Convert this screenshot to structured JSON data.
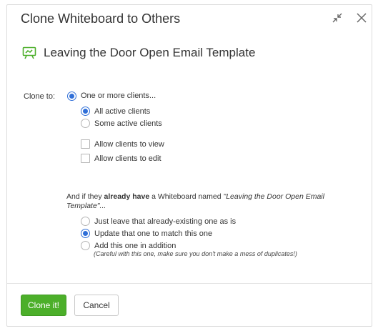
{
  "dialog": {
    "title": "Clone Whiteboard to Others",
    "header_icons": [
      "minimize-icon",
      "close-icon"
    ]
  },
  "whiteboard": {
    "icon": "whiteboard-icon",
    "name": "Leaving the Door Open Email Template",
    "accent_color": "#4caf2a"
  },
  "clone_to": {
    "label": "Clone to:",
    "option_label": "One or more clients...",
    "option_checked": true,
    "scope_options": [
      {
        "label": "All active clients",
        "checked": true
      },
      {
        "label": "Some active clients",
        "checked": false
      }
    ],
    "permissions": [
      {
        "label": "Allow clients to view",
        "checked": false
      },
      {
        "label": "Allow clients to edit",
        "checked": false
      }
    ]
  },
  "existing": {
    "question_prefix": "And if they ",
    "question_bold": "already have",
    "question_mid": " a Whiteboard named ",
    "question_name": "\"Leaving the Door Open Email Template\"",
    "question_suffix": "...",
    "options": [
      {
        "label": "Just leave that already-existing one as is",
        "checked": false
      },
      {
        "label": "Update that one to match this one",
        "checked": true
      },
      {
        "label": "Add this one in addition",
        "checked": false
      }
    ],
    "note": "(Careful with this one, make sure you don't make a mess of duplicates!)"
  },
  "footer": {
    "primary_label": "Clone it!",
    "secondary_label": "Cancel",
    "primary_color": "#4caf2a"
  }
}
